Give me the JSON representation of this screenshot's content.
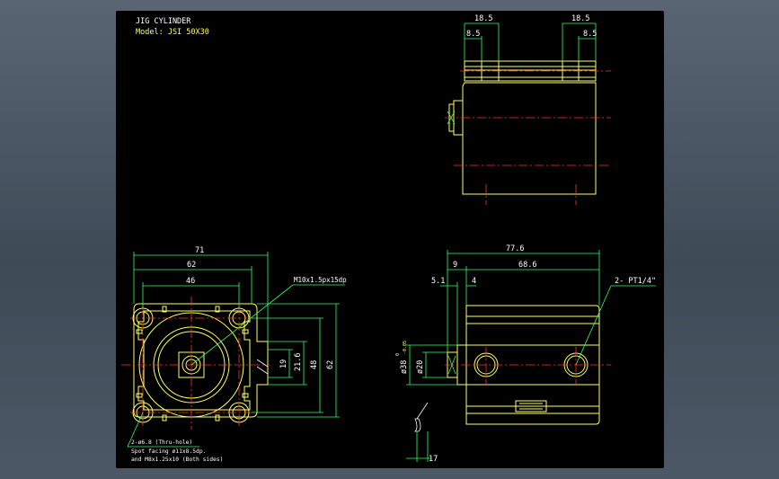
{
  "title": {
    "line1": "JIG CYLINDER",
    "line2": "Model: JSI 50X30"
  },
  "top_view": {
    "dims": [
      "18.5",
      "8.5",
      "18.5",
      "8.5"
    ]
  },
  "front_view": {
    "dims": [
      "71",
      "62",
      "46",
      "21.6",
      "19",
      "48",
      "62"
    ],
    "callout_thread": "M10x1.5px15dp",
    "note_lines": [
      "2-ø6.8 (Thru-hole)",
      "Spot facing ø11x8.5dp.",
      "and M8x1.25x10 (Both sides)"
    ]
  },
  "side_view": {
    "dims": [
      "77.6",
      "9",
      "68.6",
      "5.1",
      "4",
      "ø20",
      "ø38",
      "17"
    ],
    "tol_upper": "0",
    "tol_lower": "-0.05",
    "callout_port": "2- PT1/4\""
  },
  "colors": {
    "outline": "#ffff66",
    "dimension": "#33ff66",
    "centerline": "#ff3030",
    "text": "#ffffff",
    "viewport": "#000000"
  }
}
